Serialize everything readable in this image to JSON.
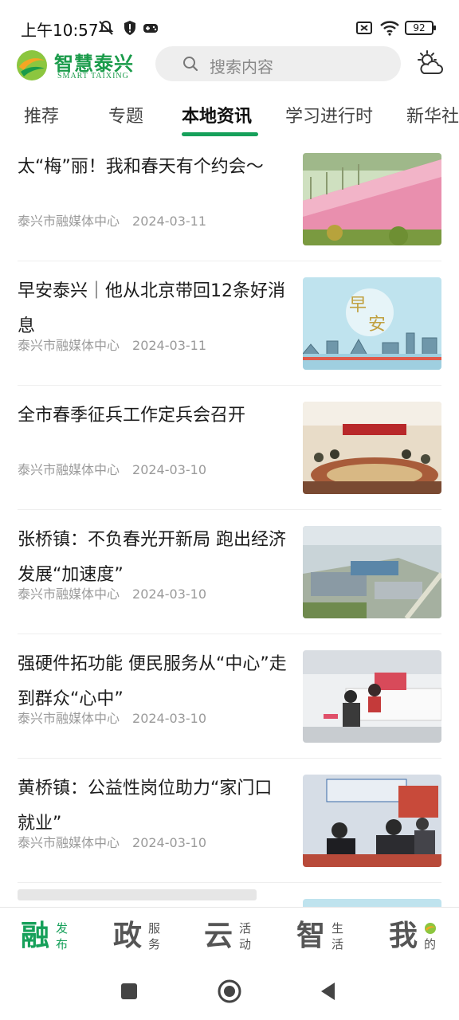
{
  "status_bar": {
    "time": "上午10:57",
    "battery": "92"
  },
  "header": {
    "logo_cn": "智慧泰兴",
    "logo_en": "SMART TAIXING",
    "search_placeholder": "搜索内容",
    "weather_icon": "partly-cloudy-icon"
  },
  "tabs": [
    "推荐",
    "专题",
    "本地资讯",
    "学习进行时",
    "新华社"
  ],
  "active_tab": "本地资讯",
  "articles": [
    {
      "title": "太“梅”丽！我和春天有个约会～",
      "source": "泰兴市融媒体中心",
      "date": "2024-03-11"
    },
    {
      "title": "早安泰兴｜他从北京带回12条好消息",
      "source": "泰兴市融媒体中心",
      "date": "2024-03-11"
    },
    {
      "title": "全市春季征兵工作定兵会召开",
      "source": "泰兴市融媒体中心",
      "date": "2024-03-10"
    },
    {
      "title": "张桥镇：不负春光开新局 跑出经济发展“加速度”",
      "source": "泰兴市融媒体中心",
      "date": "2024-03-10"
    },
    {
      "title": "强硬件拓功能 便民服务从“中心”走到群众“心中”",
      "source": "泰兴市融媒体中心",
      "date": "2024-03-10"
    },
    {
      "title": "黄桥镇：公益性岗位助力“家门口就业”",
      "source": "泰兴市融媒体中心",
      "date": "2024-03-10"
    }
  ],
  "bottom_nav": [
    {
      "big": "融",
      "small": "发布"
    },
    {
      "big": "政",
      "small": "服务"
    },
    {
      "big": "云",
      "small": "活动"
    },
    {
      "big": "智",
      "small": "生活"
    },
    {
      "big": "我",
      "small": "的"
    }
  ],
  "colors": {
    "accent": "#16a05a",
    "text": "#1c1c1c",
    "meta": "#9a9a9a"
  }
}
